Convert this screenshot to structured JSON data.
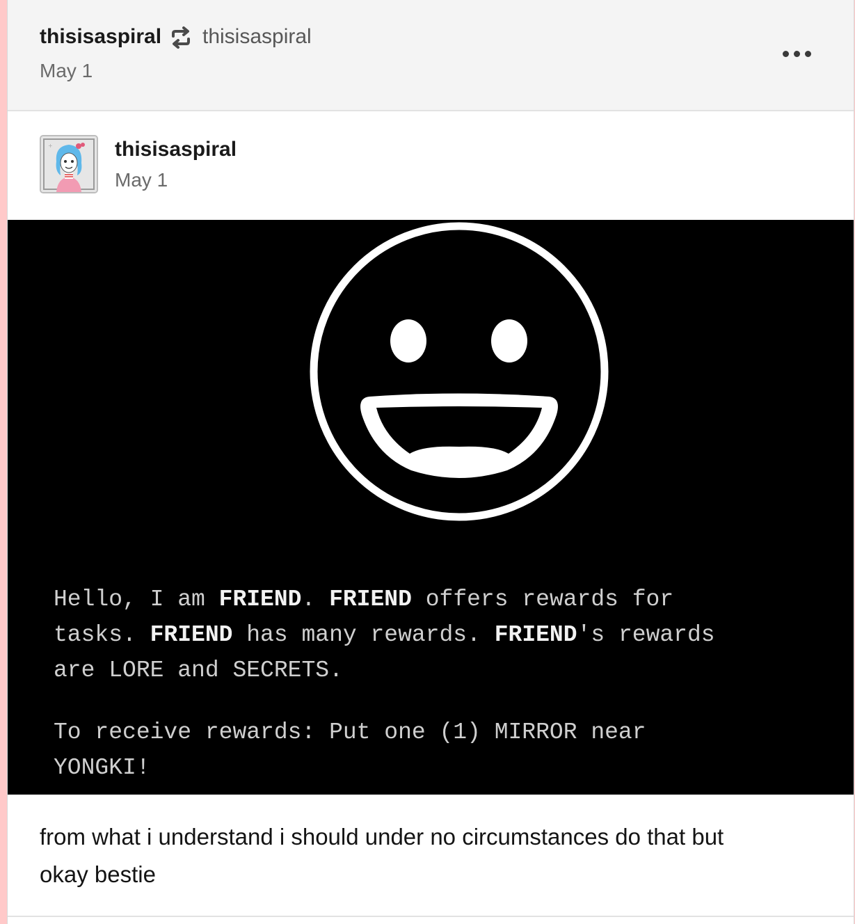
{
  "reblog_header": {
    "user": "thisisaspiral",
    "reblog_icon": "reblog-icon",
    "source_user": "thisisaspiral",
    "date": "May 1",
    "more_icon": "more-icon"
  },
  "post": {
    "user": "thisisaspiral",
    "date": "May 1",
    "avatar_icon": "avatar-image",
    "image": {
      "icon": "grinning-smiley-icon",
      "line1": {
        "a": "Hello, I am ",
        "b": "FRIEND",
        "c": ". ",
        "d": "FRIEND",
        "e": " offers rewards for"
      },
      "line2": {
        "a": "tasks. ",
        "b": "FRIEND",
        "c": " has many rewards. ",
        "d": "FRIEND",
        "e": "'s rewards"
      },
      "line3": "are LORE and SECRETS.",
      "line4": "To receive rewards: Put one (1) MIRROR near",
      "line5": "YONGKI!"
    },
    "caption_line1": "from what i understand i should under no circumstances do that but",
    "caption_line2": "okay bestie"
  },
  "colors": {
    "page_background": "#ffc9c9",
    "header_background": "#f4f4f4",
    "image_background": "#000000"
  }
}
